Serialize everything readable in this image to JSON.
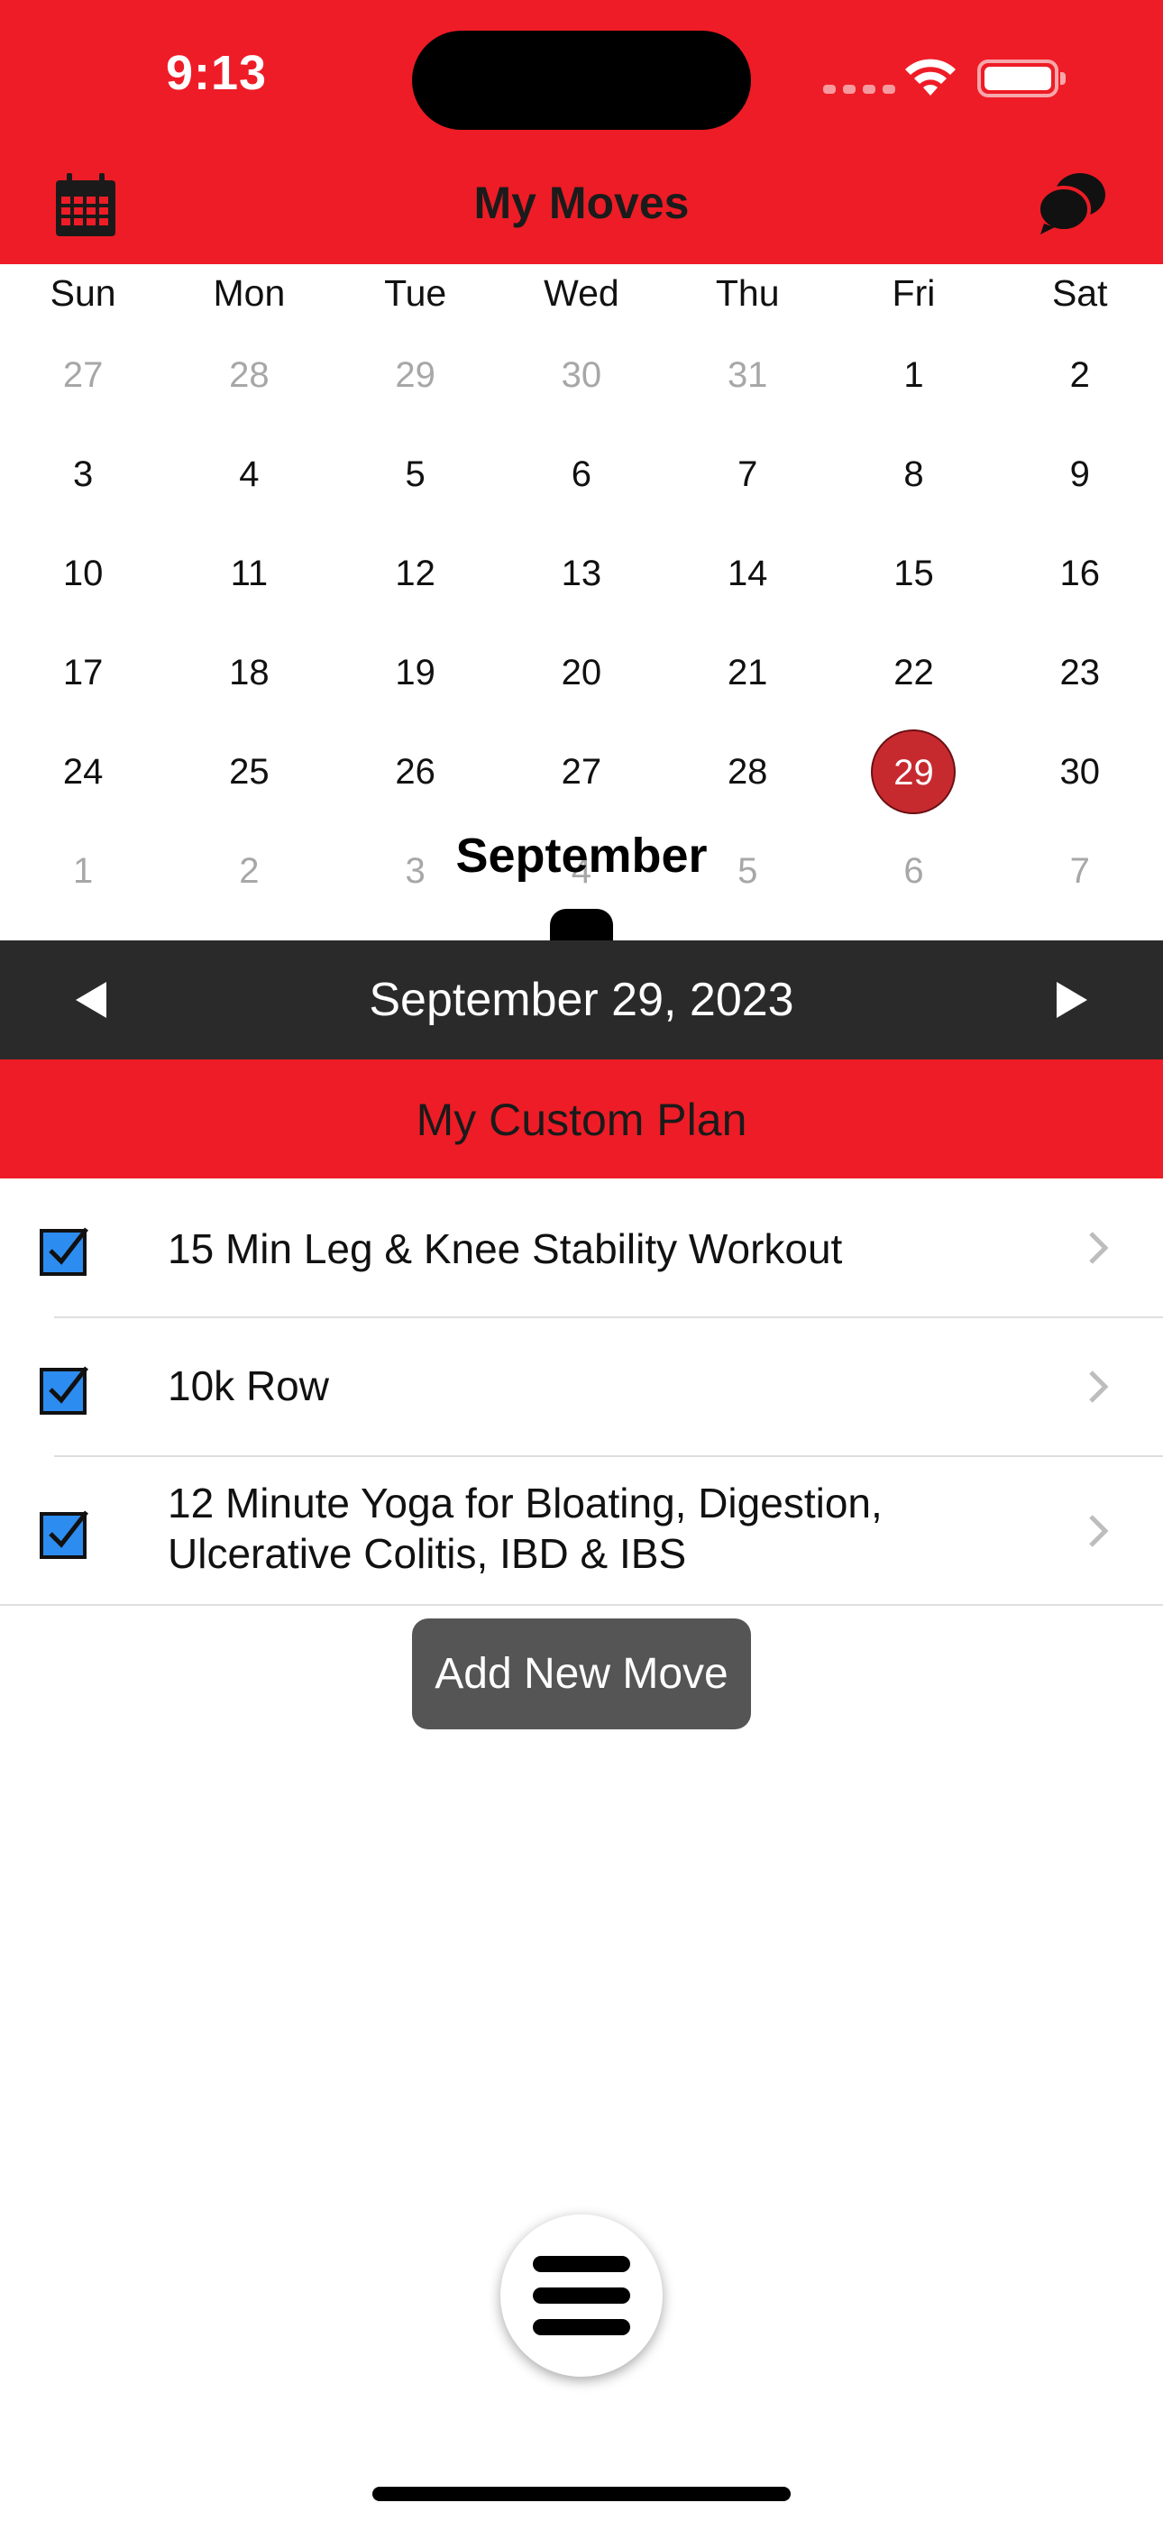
{
  "status_bar": {
    "time": "9:13"
  },
  "nav": {
    "title": "My Moves",
    "left_icon": "calendar-icon",
    "right_icon": "chat-bubbles-icon"
  },
  "calendar": {
    "weekdays": [
      "Sun",
      "Mon",
      "Tue",
      "Wed",
      "Thu",
      "Fri",
      "Sat"
    ],
    "weeks": [
      [
        {
          "d": "27",
          "m": true
        },
        {
          "d": "28",
          "m": true
        },
        {
          "d": "29",
          "m": true
        },
        {
          "d": "30",
          "m": true
        },
        {
          "d": "31",
          "m": true
        },
        {
          "d": "1",
          "m": false
        },
        {
          "d": "2",
          "m": false
        }
      ],
      [
        {
          "d": "3",
          "m": false
        },
        {
          "d": "4",
          "m": false
        },
        {
          "d": "5",
          "m": false
        },
        {
          "d": "6",
          "m": false
        },
        {
          "d": "7",
          "m": false
        },
        {
          "d": "8",
          "m": false
        },
        {
          "d": "9",
          "m": false
        }
      ],
      [
        {
          "d": "10",
          "m": false
        },
        {
          "d": "11",
          "m": false
        },
        {
          "d": "12",
          "m": false
        },
        {
          "d": "13",
          "m": false
        },
        {
          "d": "14",
          "m": false
        },
        {
          "d": "15",
          "m": false
        },
        {
          "d": "16",
          "m": false
        }
      ],
      [
        {
          "d": "17",
          "m": false
        },
        {
          "d": "18",
          "m": false
        },
        {
          "d": "19",
          "m": false
        },
        {
          "d": "20",
          "m": false
        },
        {
          "d": "21",
          "m": false
        },
        {
          "d": "22",
          "m": false
        },
        {
          "d": "23",
          "m": false
        }
      ],
      [
        {
          "d": "24",
          "m": false
        },
        {
          "d": "25",
          "m": false
        },
        {
          "d": "26",
          "m": false
        },
        {
          "d": "27",
          "m": false
        },
        {
          "d": "28",
          "m": false
        },
        {
          "d": "29",
          "m": false,
          "selected": true
        },
        {
          "d": "30",
          "m": false
        }
      ],
      [
        {
          "d": "1",
          "m": true
        },
        {
          "d": "2",
          "m": true
        },
        {
          "d": "3",
          "m": true
        },
        {
          "d": "4",
          "m": true
        },
        {
          "d": "5",
          "m": true
        },
        {
          "d": "6",
          "m": true
        },
        {
          "d": "7",
          "m": true
        }
      ]
    ],
    "month_label": "September",
    "selected_color": "#c62a2f"
  },
  "date_bar": {
    "prev_icon": "triangle-left-icon",
    "date": "September 29, 2023",
    "next_icon": "triangle-right-icon"
  },
  "plan": {
    "title": "My Custom Plan"
  },
  "moves": [
    {
      "label": "15 Min Leg & Knee Stability Workout",
      "checked": true
    },
    {
      "label": "10k Row",
      "checked": true
    },
    {
      "label": "12 Minute Yoga for Bloating, Digestion, Ulcerative Colitis, IBD & IBS",
      "checked": true
    }
  ],
  "add_button": {
    "label": "Add New Move"
  },
  "menu_button": {
    "icon": "hamburger-menu-icon"
  },
  "colors": {
    "brand_red": "#ee1c26",
    "dark_bar": "#2a2a2a",
    "checkbox_blue": "#2d8cf0",
    "button_gray": "#555555"
  }
}
